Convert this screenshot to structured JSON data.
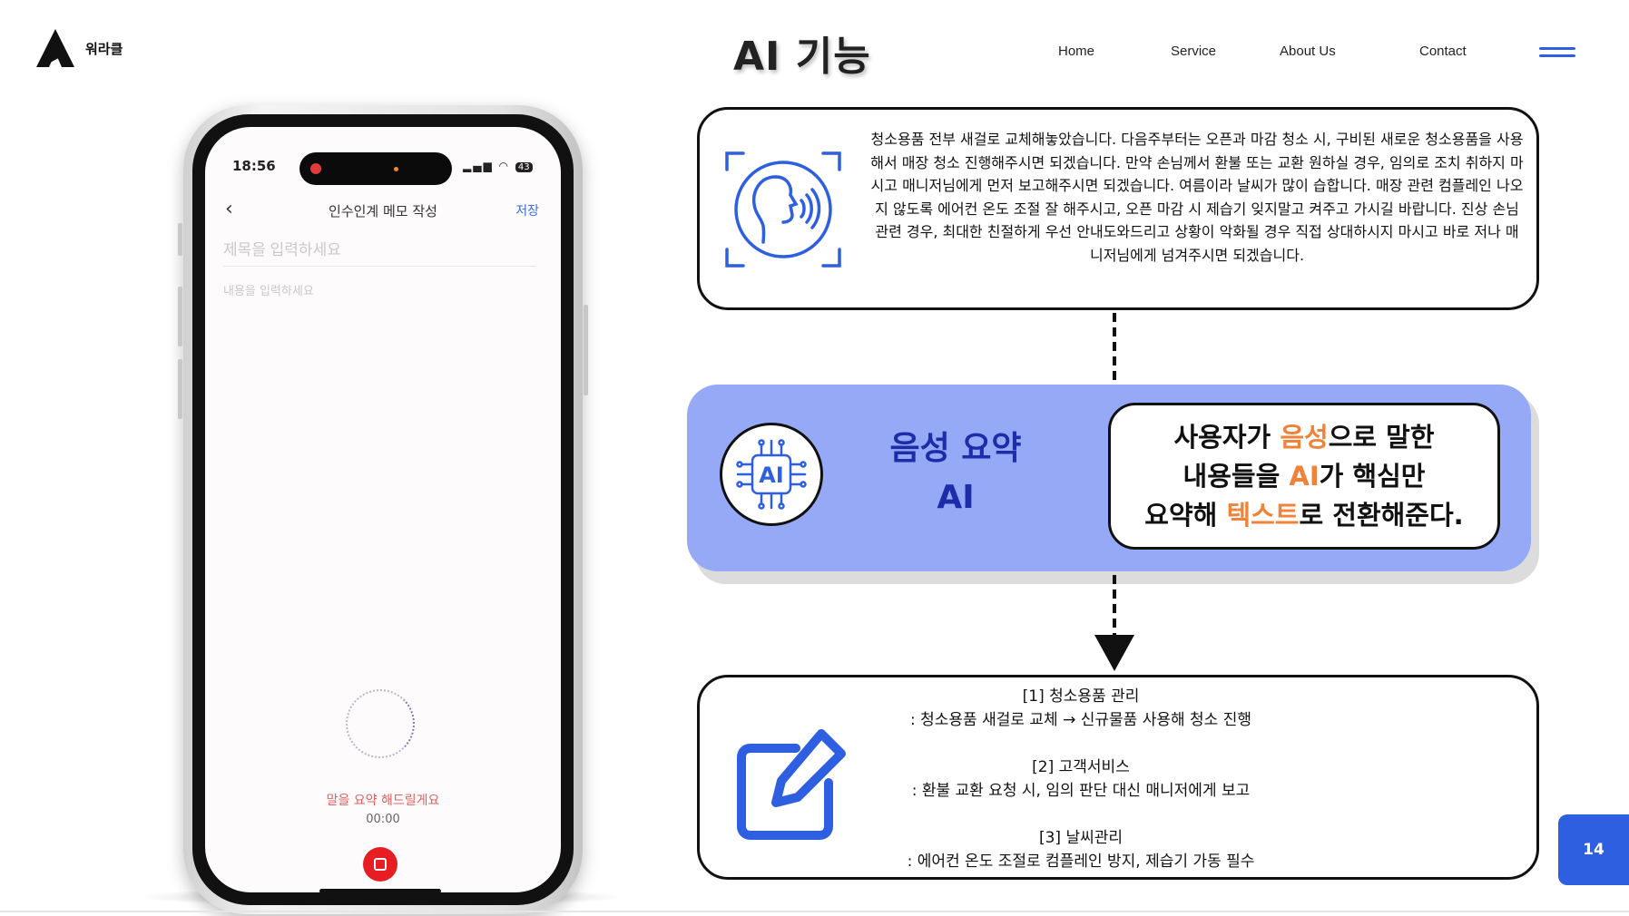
{
  "header": {
    "logo_text": "워라클",
    "page_title": "AI 기능",
    "nav": [
      {
        "label": "Home"
      },
      {
        "label": "Service"
      },
      {
        "label": "About Us"
      },
      {
        "label": "Contact"
      }
    ],
    "menu_icon": "hamburger-icon"
  },
  "phone": {
    "time": "18:56",
    "status_icons": "signal-wifi-battery",
    "battery": "43",
    "memo_title": "인수인계 메모 작성",
    "save_label": "저장",
    "title_placeholder": "제목을 입력하세요",
    "content_placeholder": "내용을 입력하세요",
    "summary_label": "말을 요약 해드릴게요",
    "timer": "00:00"
  },
  "transcript": {
    "text": "청소용품 전부 새걸로 교체해놓았습니다. 다음주부터는 오픈과 마감 청소 시, 구비된 새로운 청소용품을 사용해서 매장 청소 진행해주시면 되겠습니다. 만약 손님께서 환불 또는 교환 원하실 경우, 임의로 조치 취하지 마시고 매니저님에게 먼저 보고해주시면 되겠습니다. 여름이라 날씨가 많이 습합니다. 매장 관련 컴플레인 나오지 않도록 에어컨 온도 조절 잘 해주시고, 오픈 마감 시 제습기 잊지말고 켜주고 가시길 바랍니다. 진상 손님 관련 경우, 최대한 친절하게 우선 안내도와드리고 상황이 악화될 경우 직접 상대하시지 마시고 바로 저나 매니저님에게 넘겨주시면 되겠습니다."
  },
  "ai_panel": {
    "chip_label": "AI",
    "title_line1": "음성 요약",
    "title_line2": "AI",
    "desc": {
      "l1_a": "사용자가 ",
      "l1_hl": "음성",
      "l1_b": "으로 말한",
      "l2_a": "내용들을 ",
      "l2_hl": "AI",
      "l2_b": "가 핵심만",
      "l3_a": "요약해 ",
      "l3_hl": "텍스트",
      "l3_b": "로 전환해준다."
    },
    "highlight_color": "#f0823a",
    "panel_color": "#95a9f6",
    "title_color": "#1d2ca8"
  },
  "summary": {
    "items": [
      {
        "heading": "[1] 청소용품 관리",
        "detail": ": 청소용품 새걸로 교체 → 신규물품 사용해 청소 진행"
      },
      {
        "heading": "[2] 고객서비스",
        "detail": ": 환불 교환 요청 시, 임의 판단 대신 매니저에게 보고"
      },
      {
        "heading": "[3] 날씨관리",
        "detail": ": 에어컨 온도 조절로 컴플레인 방지, 제습기 가동 필수"
      }
    ]
  },
  "page_number": "14",
  "accent_color": "#2e5fe0"
}
